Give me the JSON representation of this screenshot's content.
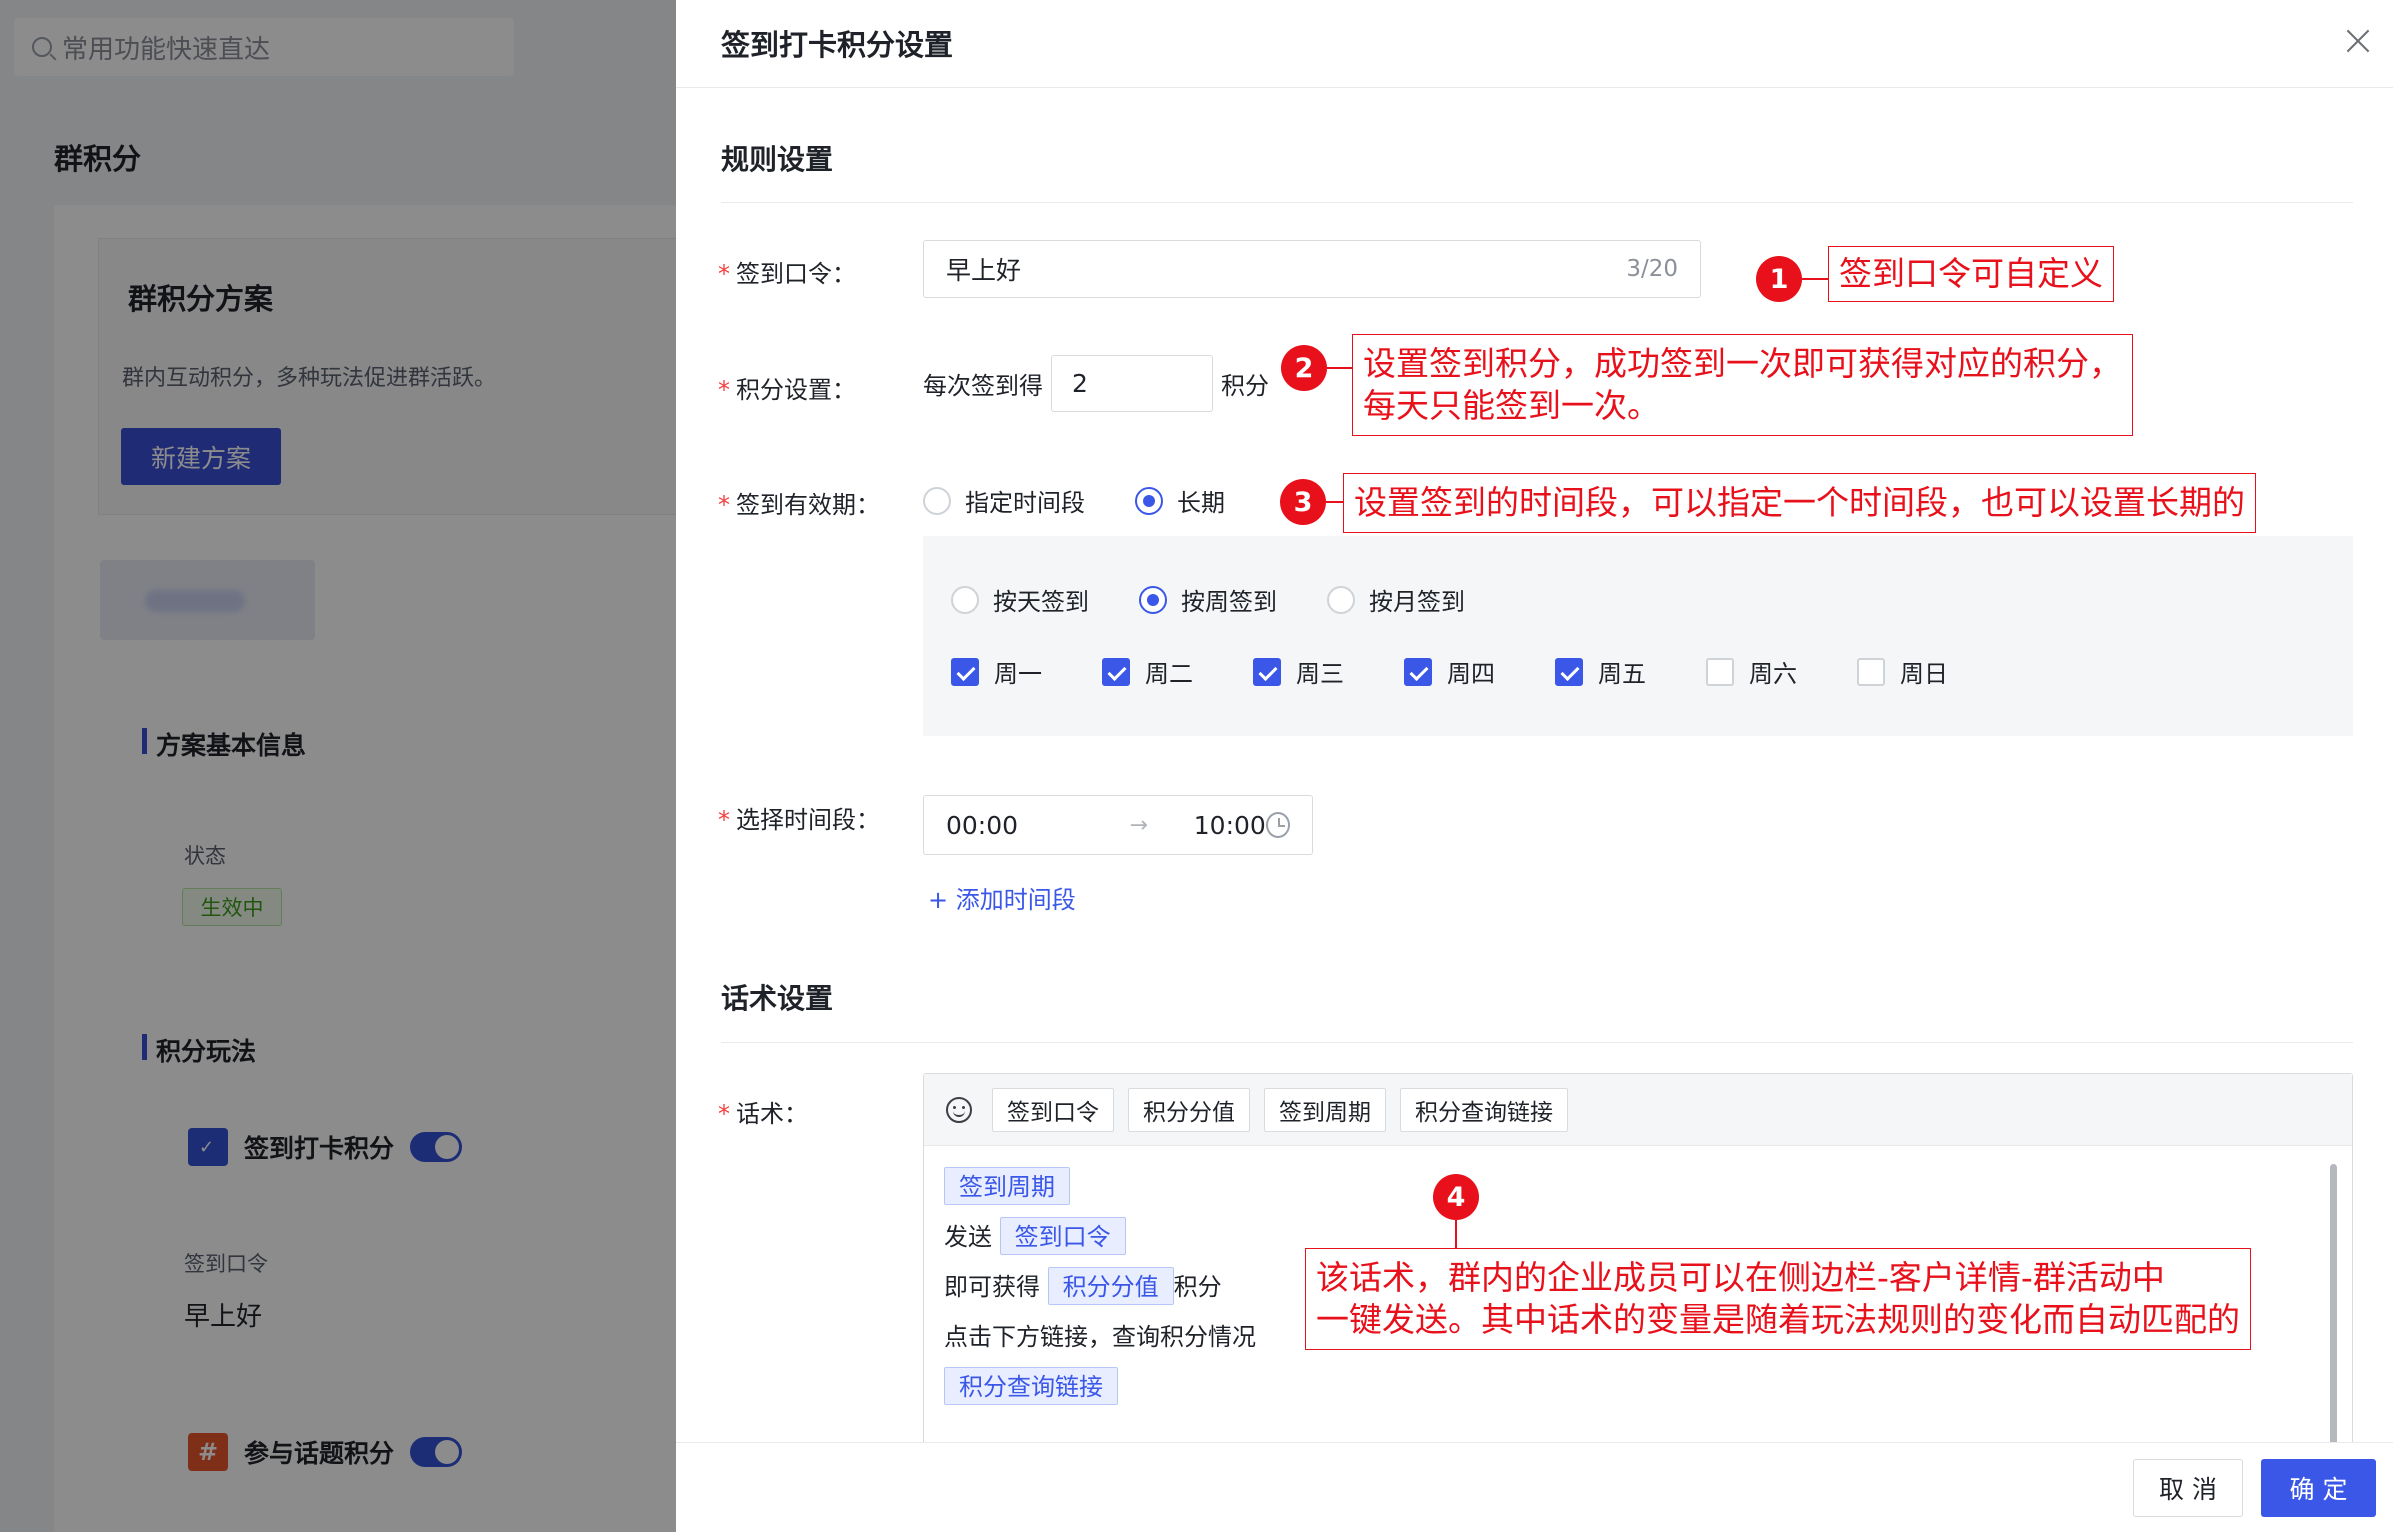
{
  "background": {
    "search_placeholder": "常用功能快速直达",
    "page_title": "群积分",
    "plan_card": {
      "title": "群积分方案",
      "description": "群内互动积分，多种玩法促进群活跃。",
      "new_button": "新建方案"
    },
    "basic_info_title": "方案基本信息",
    "status_label": "状态",
    "status_value": "生效中",
    "gameplay_title": "积分玩法",
    "gameplay_items": [
      {
        "label": "签到打卡积分",
        "icon": "calendar-check-icon",
        "enabled": true
      },
      {
        "label": "参与话题积分",
        "icon": "hash-icon",
        "enabled": true
      }
    ],
    "checkin_code_label": "签到口令",
    "checkin_code_value": "早上好"
  },
  "drawer": {
    "title": "签到打卡积分设置",
    "rule_section_title": "规则设置",
    "checkin_code": {
      "label": "签到口令：",
      "value": "早上好",
      "counter": "3/20"
    },
    "points": {
      "label": "积分设置：",
      "prefix": "每次签到得",
      "value": "2",
      "suffix": "积分"
    },
    "validity": {
      "label": "签到有效期：",
      "options": [
        {
          "label": "指定时间段",
          "selected": false
        },
        {
          "label": "长期",
          "selected": true
        }
      ]
    },
    "frequency": {
      "options": [
        {
          "label": "按天签到",
          "selected": false
        },
        {
          "label": "按周签到",
          "selected": true
        },
        {
          "label": "按月签到",
          "selected": false
        }
      ],
      "days": [
        {
          "label": "周一",
          "checked": true
        },
        {
          "label": "周二",
          "checked": true
        },
        {
          "label": "周三",
          "checked": true
        },
        {
          "label": "周四",
          "checked": true
        },
        {
          "label": "周五",
          "checked": true
        },
        {
          "label": "周六",
          "checked": false
        },
        {
          "label": "周日",
          "checked": false
        }
      ]
    },
    "time_range": {
      "label": "选择时间段：",
      "start": "00:00",
      "arrow": "→",
      "end": "10:00",
      "add_link": "+ 添加时间段"
    },
    "script_section_title": "话术设置",
    "script": {
      "label": "话术：",
      "toolbar_buttons": [
        "签到口令",
        "积分分值",
        "签到周期",
        "积分查询链接"
      ],
      "body": {
        "line1_tag": "签到周期",
        "line2_text": "发送",
        "line2_tag": "签到口令",
        "line3_text": "即可获得",
        "line3_tag": "积分分值",
        "line3_suffix": "积分",
        "line4_text": "点击下方链接，查询积分情况",
        "line5_tag": "积分查询链接"
      }
    },
    "footer": {
      "cancel": "取 消",
      "ok": "确 定"
    }
  },
  "annotations": [
    {
      "number": "1",
      "text": "签到口令可自定义"
    },
    {
      "number": "2",
      "line1": "设置签到积分，成功签到一次即可获得对应的积分，",
      "line2": "每天只能签到一次。"
    },
    {
      "number": "3",
      "text": "设置签到的时间段，可以指定一个时间段，也可以设置长期的"
    },
    {
      "number": "4",
      "line1": "该话术，群内的企业成员可以在侧边栏-客户详情-群活动中",
      "line2": "一键发送。其中话术的变量是随着玩法规则的变化而自动匹配的"
    }
  ],
  "colors": {
    "primary": "#3a57e8",
    "annotation_red": "#e8101a",
    "required_star": "#f53f3f"
  }
}
